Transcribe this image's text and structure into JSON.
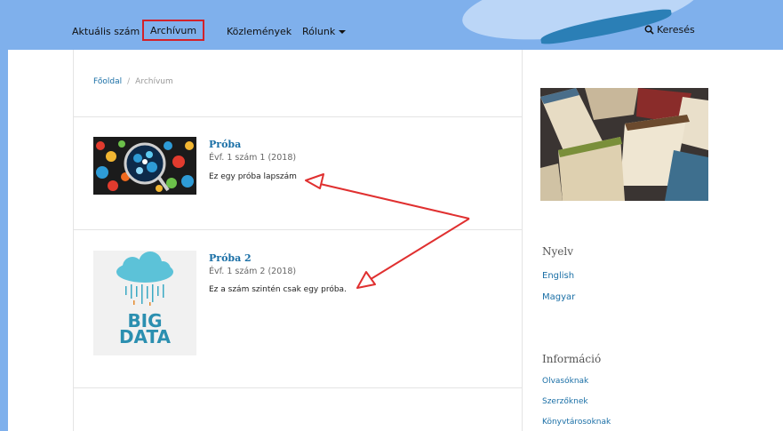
{
  "nav": {
    "items": [
      {
        "label": "Aktuális szám"
      },
      {
        "label": "Archívum"
      },
      {
        "label": "Közlemények"
      },
      {
        "label": "Rólunk"
      }
    ],
    "search_label": "Keresés"
  },
  "breadcrumb": {
    "home": "Főoldal",
    "separator": "/",
    "current": "Archívum"
  },
  "issues": [
    {
      "title": "Próba",
      "meta": "Évf. 1 szám 1 (2018)",
      "description": "Ez egy próba lapszám",
      "cover_icon": "colorful-circles-magnifier-image"
    },
    {
      "title": "Próba 2",
      "meta": "Évf. 1 szám 2 (2018)",
      "description": "Ez a szám szintén csak egy próba.",
      "cover_icon": "big-data-cloud-image",
      "cover_text_1": "BIG",
      "cover_text_2": "DATA"
    }
  ],
  "sidebar": {
    "image_icon": "books-photo",
    "language": {
      "heading": "Nyelv",
      "links": [
        "English",
        "Magyar"
      ]
    },
    "info": {
      "heading": "Információ",
      "links": [
        "Olvasóknak",
        "Szerzőknek",
        "Könyvtárosoknak"
      ]
    }
  },
  "colors": {
    "navbar": "#7fb0ec",
    "link": "#1a6fa6",
    "highlight_box": "#d2222a",
    "annotation_arrow": "#e03030"
  }
}
